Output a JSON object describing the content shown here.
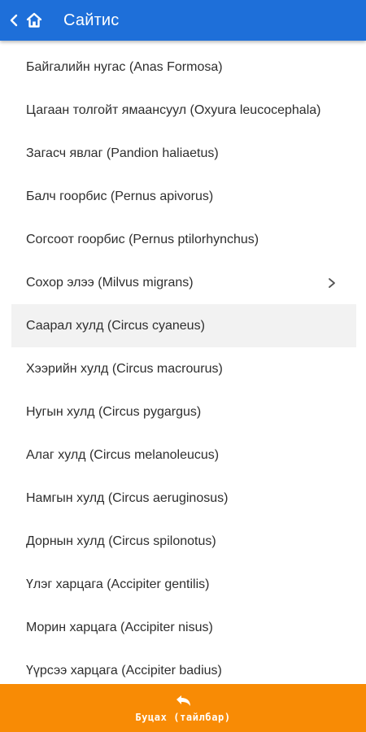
{
  "header": {
    "title": "Сайтис",
    "back_icon": "chevron-left-icon",
    "home_icon": "home-icon"
  },
  "colors": {
    "appbar": "#1e6fd9",
    "bottom_bar": "#f88b05",
    "selected_row": "#f2f2f2"
  },
  "list": {
    "items": [
      {
        "label": "Байгалийн нугас (Anas Formosa)"
      },
      {
        "label": "Цагаан толгойт ямаансуул (Oxyura leucocephala)"
      },
      {
        "label": "Загасч явлаг (Pandion haliaetus)"
      },
      {
        "label": "Балч гоорбис (Pernus apivorus)"
      },
      {
        "label": "Согсоот гоорбис (Pernus ptilorhynchus)"
      },
      {
        "label": "Сохор элээ (Milvus migrans)",
        "has_chevron": true
      },
      {
        "label": "Саарал хулд (Circus cyaneus)",
        "selected": true
      },
      {
        "label": "Хээрийн хулд (Circus macrourus)"
      },
      {
        "label": "Нугын хулд (Circus pygargus)"
      },
      {
        "label": "Алаг хулд (Circus melanoleucus)"
      },
      {
        "label": "Намгын хулд (Circus aeruginosus)"
      },
      {
        "label": "Дорнын хулд (Circus spilonotus)"
      },
      {
        "label": "Үлэг харцага (Accipiter gentilis)"
      },
      {
        "label": "Морин харцага (Accipiter nisus)"
      },
      {
        "label": "Үүрсээ харцага (Accipiter badius)"
      }
    ]
  },
  "bottom_bar": {
    "icon": "undo-icon",
    "label": "Буцах (тайлбар)"
  }
}
